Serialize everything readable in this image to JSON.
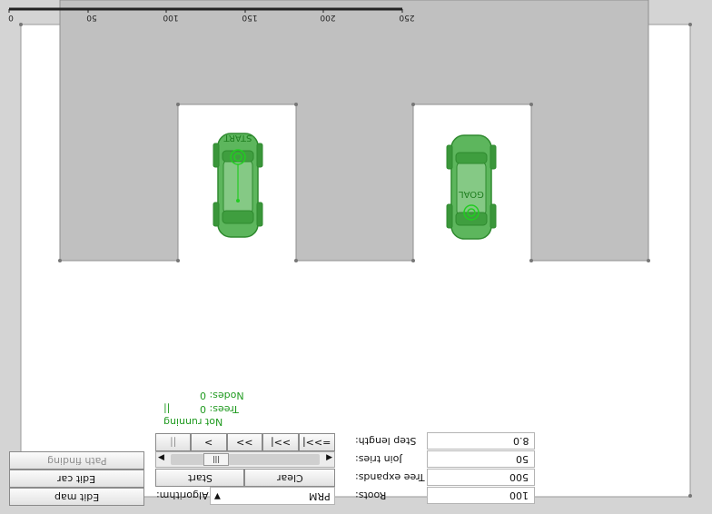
{
  "ruler": {
    "ticks": [
      "0",
      "50",
      "100",
      "150",
      "200",
      "250"
    ]
  },
  "markers": {
    "start": "START",
    "goal": "GOAL"
  },
  "modes": {
    "edit_map": "Edit map",
    "edit_car": "Edit car",
    "path_finding": "Path finding"
  },
  "algorithm": {
    "label": "Algorithm:",
    "value": "PRM"
  },
  "actions": {
    "start": "Start",
    "clear": "Clear"
  },
  "playback": {
    "pause": "||",
    "step": ">",
    "fast": ">>",
    "end": ">>|",
    "run_to_end": "=>>|"
  },
  "status": {
    "state": "Not running",
    "pause_glyph": "||",
    "trees": "Trees: 0",
    "nodes": "Nodes: 0"
  },
  "params": {
    "roots_label": "Roots:",
    "roots_value": "100",
    "tree_expands_label": "Tree expands:",
    "tree_expands_value": "500",
    "join_tries_label": "Join tries:",
    "join_tries_value": "50",
    "step_length_label": "Step length:",
    "step_length_value": "8.0"
  },
  "colors": {
    "wall": "#c0c0c0",
    "car": "#5db65d",
    "car_dark": "#2f8a2f",
    "marker": "#22cc22"
  }
}
